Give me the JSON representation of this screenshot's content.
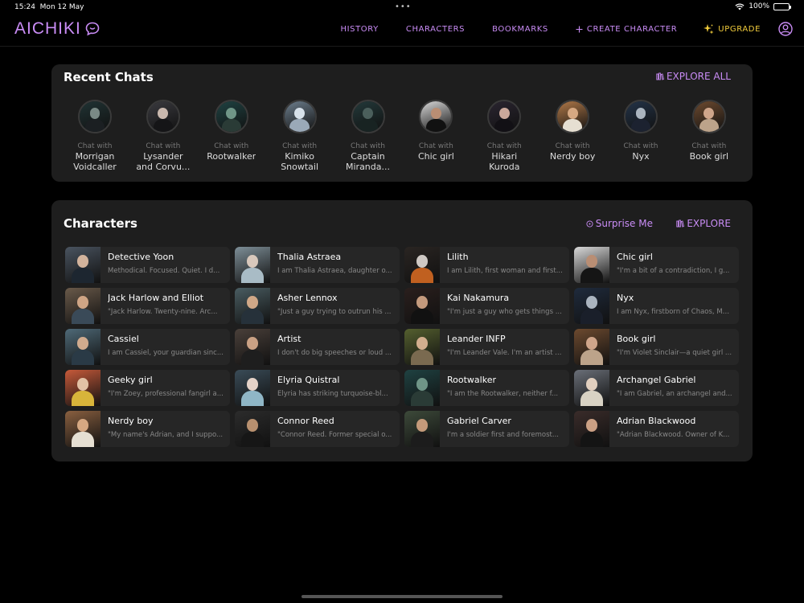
{
  "status": {
    "time": "15:24",
    "date": "Mon 12 May",
    "battery": "100%"
  },
  "nav": {
    "logo": "AICHIKI",
    "history": "HISTORY",
    "characters": "CHARACTERS",
    "bookmarks": "BOOKMARKS",
    "create": "CREATE CHARACTER",
    "upgrade": "UPGRADE"
  },
  "recent": {
    "title": "Recent Chats",
    "explore_all": "EXPLORE ALL",
    "chat_with": "Chat with",
    "items": [
      {
        "name": "Morrigan Voidcaller",
        "bg": "#203334",
        "skin": "#7a8a86",
        "cloth": "#1b1f22"
      },
      {
        "name": "Lysander and Corvu...",
        "bg": "#3a3a3f",
        "skin": "#c9b8ae",
        "cloth": "#151517"
      },
      {
        "name": "Rootwalker",
        "bg": "#1f4242",
        "skin": "#6f9587",
        "cloth": "#2a3b36"
      },
      {
        "name": "Kimiko Snowtail",
        "bg": "#6c7d8c",
        "skin": "#d7e1ea",
        "cloth": "#9aa9b8"
      },
      {
        "name": "Captain Miranda...",
        "bg": "#23393a",
        "skin": "#4b5f5c",
        "cloth": "#182322"
      },
      {
        "name": "Chic girl",
        "bg": "#d8d8d8",
        "skin": "#b98e74",
        "cloth": "#111111"
      },
      {
        "name": "Hikari Kuroda",
        "bg": "#2a2530",
        "skin": "#caa89b",
        "cloth": "#121015"
      },
      {
        "name": "Nerdy boy",
        "bg": "#b07848",
        "skin": "#d6a882",
        "cloth": "#e6dfd2"
      },
      {
        "name": "Nyx",
        "bg": "#233348",
        "skin": "#aab4bf",
        "cloth": "#1c2230"
      },
      {
        "name": "Book girl",
        "bg": "#6d4a2f",
        "skin": "#cfa58a",
        "cloth": "#bca38a"
      }
    ]
  },
  "characters": {
    "title": "Characters",
    "surprise": "Surprise Me",
    "explore": "EXPLORE",
    "items": [
      {
        "name": "Detective Yoon",
        "desc": "Methodical. Focused. Quiet. I d...",
        "bg": "#4a5460",
        "skin": "#d2b39c",
        "cloth": "#1d2630"
      },
      {
        "name": "Thalia Astraea",
        "desc": "I am Thalia Astraea, daughter o...",
        "bg": "#7e8f98",
        "skin": "#d8c8bc",
        "cloth": "#a9bcc6"
      },
      {
        "name": "Lilith",
        "desc": "I am Lilith, first woman and first...",
        "bg": "#2a2522",
        "skin": "#cfc9c4",
        "cloth": "#c06020"
      },
      {
        "name": "Chic girl",
        "desc": "\"I'm a bit of a contradiction, I g...",
        "bg": "#d9d9d9",
        "skin": "#b98e74",
        "cloth": "#151515"
      },
      {
        "name": "Jack Harlow and Elliot",
        "desc": "\"Jack Harlow. Twenty-nine. Arc...",
        "bg": "#6a5a4a",
        "skin": "#cfa585",
        "cloth": "#3a4a58"
      },
      {
        "name": "Asher Lennox",
        "desc": "\"Just a guy trying to outrun his ...",
        "bg": "#4a5d62",
        "skin": "#d0a887",
        "cloth": "#26313a"
      },
      {
        "name": "Kai Nakamura",
        "desc": "\"I'm just a guy who gets things ...",
        "bg": "#2a1f1d",
        "skin": "#c49a7d",
        "cloth": "#111111"
      },
      {
        "name": "Nyx",
        "desc": "I am Nyx, firstborn of Chaos, Mo...",
        "bg": "#1f2b3d",
        "skin": "#aab4bf",
        "cloth": "#1a1f2a"
      },
      {
        "name": "Cassiel",
        "desc": "I am Cassiel, your guardian sinc...",
        "bg": "#4f6a78",
        "skin": "#d0ab8e",
        "cloth": "#2a3a46"
      },
      {
        "name": "Artist",
        "desc": "I don't do big speeches or loud ...",
        "bg": "#4a403a",
        "skin": "#caa184",
        "cloth": "#1e1e1e"
      },
      {
        "name": "Leander INFP",
        "desc": "\"I'm Leander Vale. I'm an artist ...",
        "bg": "#55602f",
        "skin": "#d2ae8e",
        "cloth": "#7a6a50"
      },
      {
        "name": "Book girl",
        "desc": "\"I'm Violet Sinclair—a quiet girl ...",
        "bg": "#6d4a2f",
        "skin": "#cfa58a",
        "cloth": "#bca38a"
      },
      {
        "name": "Geeky girl",
        "desc": "\"I'm Zoey, professional fangirl a...",
        "bg": "#c75a3a",
        "skin": "#e2c1a5",
        "cloth": "#d8b43a"
      },
      {
        "name": "Elyria Quistral",
        "desc": "Elyria has striking turquoise-bl...",
        "bg": "#3a4c58",
        "skin": "#e3d2c8",
        "cloth": "#8fb6c6"
      },
      {
        "name": "Rootwalker",
        "desc": "\"I am the Rootwalker, neither f...",
        "bg": "#1f4242",
        "skin": "#6f9587",
        "cloth": "#2a3b36"
      },
      {
        "name": "Archangel Gabriel",
        "desc": "\"I am Gabriel, an archangel and...",
        "bg": "#6a6f78",
        "skin": "#e1cfbf",
        "cloth": "#d8d2c4"
      },
      {
        "name": "Nerdy boy",
        "desc": "\"My name's Adrian, and I suppo...",
        "bg": "#8a6040",
        "skin": "#d6a882",
        "cloth": "#e6dfd2"
      },
      {
        "name": "Connor Reed",
        "desc": "\"Connor Reed. Former special o...",
        "bg": "#2c2c2c",
        "skin": "#b8906f",
        "cloth": "#161616"
      },
      {
        "name": "Gabriel Carver",
        "desc": "I'm a soldier first and foremost...",
        "bg": "#3d4a3a",
        "skin": "#c49a7a",
        "cloth": "#1c1c1c"
      },
      {
        "name": "Adrian Blackwood",
        "desc": "\"Adrian Blackwood. Owner of K...",
        "bg": "#3a2c2a",
        "skin": "#cba084",
        "cloth": "#141414"
      }
    ]
  }
}
